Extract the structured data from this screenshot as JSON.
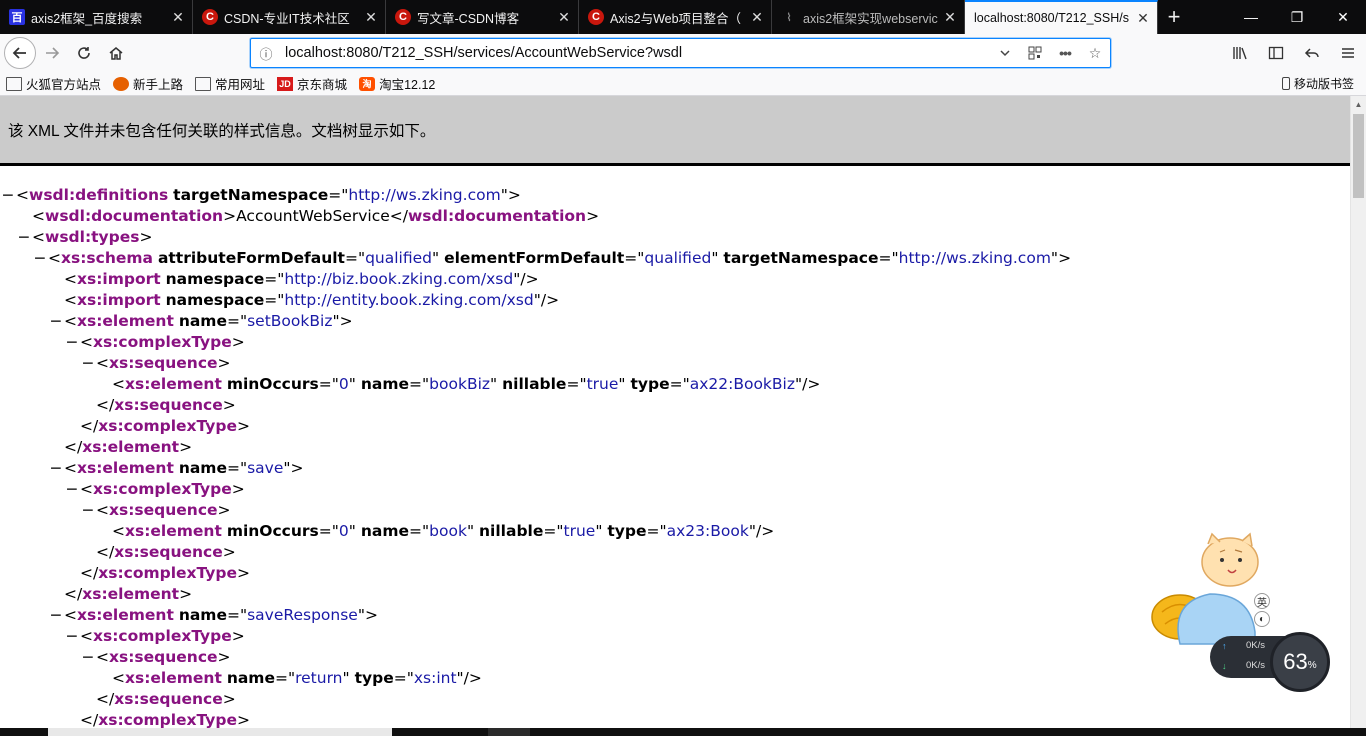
{
  "tabs": [
    {
      "title": "axis2框架_百度搜索",
      "favicon": "baidu-icon",
      "fav_text": "百"
    },
    {
      "title": "CSDN-专业IT技术社区",
      "favicon": "csdn-icon",
      "fav_text": "C"
    },
    {
      "title": "写文章-CSDN博客",
      "favicon": "csdn-icon",
      "fav_text": "C"
    },
    {
      "title": "Axis2与Web项目整合（",
      "favicon": "csdn-icon",
      "fav_text": "C"
    },
    {
      "title": "axis2框架实现webservic",
      "favicon": "gray-icon",
      "fav_text": "⌇"
    },
    {
      "title": "localhost:8080/T212_SSH/s",
      "favicon": "none",
      "fav_text": ""
    }
  ],
  "nav": {
    "url": "localhost:8080/T212_SSH/services/AccountWebService?wsdl",
    "page_actions_label": "•••"
  },
  "bookmarks": [
    {
      "label": "火狐官方站点",
      "icon": "folder-icon",
      "icon_text": ""
    },
    {
      "label": "新手上路",
      "icon": "firefox-icon",
      "icon_text": ""
    },
    {
      "label": "常用网址",
      "icon": "folder-icon",
      "icon_text": ""
    },
    {
      "label": "京东商城",
      "icon": "jd-icon",
      "icon_text": "JD"
    },
    {
      "label": "淘宝12.12",
      "icon": "taobao-icon",
      "icon_text": "淘"
    }
  ],
  "mobile_bookmarks": "移动版书签",
  "xml_notice": "该 XML 文件并未包含任何关联的样式信息。文档树显示如下。",
  "xml_lines": [
    {
      "indent": 0,
      "twisty": "−",
      "kind": "open",
      "tag": "wsdl:definitions",
      "attrs": [
        {
          "n": "targetNamespace",
          "v": "http://ws.zking.com"
        }
      ]
    },
    {
      "indent": 1,
      "twisty": "",
      "kind": "text",
      "tag": "wsdl:documentation",
      "text": "AccountWebService"
    },
    {
      "indent": 1,
      "twisty": "−",
      "kind": "open",
      "tag": "wsdl:types",
      "attrs": []
    },
    {
      "indent": 2,
      "twisty": "−",
      "kind": "open",
      "tag": "xs:schema",
      "attrs": [
        {
          "n": "attributeFormDefault",
          "v": "qualified"
        },
        {
          "n": "elementFormDefault",
          "v": "qualified"
        },
        {
          "n": "targetNamespace",
          "v": "http://ws.zking.com"
        }
      ]
    },
    {
      "indent": 3,
      "twisty": "",
      "kind": "empty",
      "tag": "xs:import",
      "attrs": [
        {
          "n": "namespace",
          "v": "http://biz.book.zking.com/xsd"
        }
      ]
    },
    {
      "indent": 3,
      "twisty": "",
      "kind": "empty",
      "tag": "xs:import",
      "attrs": [
        {
          "n": "namespace",
          "v": "http://entity.book.zking.com/xsd"
        }
      ]
    },
    {
      "indent": 3,
      "twisty": "−",
      "kind": "open",
      "tag": "xs:element",
      "attrs": [
        {
          "n": "name",
          "v": "setBookBiz"
        }
      ]
    },
    {
      "indent": 4,
      "twisty": "−",
      "kind": "open",
      "tag": "xs:complexType",
      "attrs": []
    },
    {
      "indent": 5,
      "twisty": "−",
      "kind": "open",
      "tag": "xs:sequence",
      "attrs": []
    },
    {
      "indent": 6,
      "twisty": "",
      "kind": "empty",
      "tag": "xs:element",
      "attrs": [
        {
          "n": "minOccurs",
          "v": "0"
        },
        {
          "n": "name",
          "v": "bookBiz"
        },
        {
          "n": "nillable",
          "v": "true"
        },
        {
          "n": "type",
          "v": "ax22:BookBiz"
        }
      ]
    },
    {
      "indent": 5,
      "twisty": "",
      "kind": "close",
      "tag": "xs:sequence"
    },
    {
      "indent": 4,
      "twisty": "",
      "kind": "close",
      "tag": "xs:complexType"
    },
    {
      "indent": 3,
      "twisty": "",
      "kind": "close",
      "tag": "xs:element"
    },
    {
      "indent": 3,
      "twisty": "−",
      "kind": "open",
      "tag": "xs:element",
      "attrs": [
        {
          "n": "name",
          "v": "save"
        }
      ]
    },
    {
      "indent": 4,
      "twisty": "−",
      "kind": "open",
      "tag": "xs:complexType",
      "attrs": []
    },
    {
      "indent": 5,
      "twisty": "−",
      "kind": "open",
      "tag": "xs:sequence",
      "attrs": []
    },
    {
      "indent": 6,
      "twisty": "",
      "kind": "empty",
      "tag": "xs:element",
      "attrs": [
        {
          "n": "minOccurs",
          "v": "0"
        },
        {
          "n": "name",
          "v": "book"
        },
        {
          "n": "nillable",
          "v": "true"
        },
        {
          "n": "type",
          "v": "ax23:Book"
        }
      ]
    },
    {
      "indent": 5,
      "twisty": "",
      "kind": "close",
      "tag": "xs:sequence"
    },
    {
      "indent": 4,
      "twisty": "",
      "kind": "close",
      "tag": "xs:complexType"
    },
    {
      "indent": 3,
      "twisty": "",
      "kind": "close",
      "tag": "xs:element"
    },
    {
      "indent": 3,
      "twisty": "−",
      "kind": "open",
      "tag": "xs:element",
      "attrs": [
        {
          "n": "name",
          "v": "saveResponse"
        }
      ]
    },
    {
      "indent": 4,
      "twisty": "−",
      "kind": "open",
      "tag": "xs:complexType",
      "attrs": []
    },
    {
      "indent": 5,
      "twisty": "−",
      "kind": "open",
      "tag": "xs:sequence",
      "attrs": []
    },
    {
      "indent": 6,
      "twisty": "",
      "kind": "empty",
      "tag": "xs:element",
      "attrs": [
        {
          "n": "name",
          "v": "return"
        },
        {
          "n": "type",
          "v": "xs:int"
        }
      ]
    },
    {
      "indent": 5,
      "twisty": "",
      "kind": "close",
      "tag": "xs:sequence"
    },
    {
      "indent": 4,
      "twisty": "",
      "kind": "close",
      "tag": "xs:complexType"
    }
  ],
  "widget": {
    "upload": "0K/s",
    "download": "0K/s",
    "percent": "63",
    "percent_unit": "%",
    "chip_label": "英"
  },
  "colors": {
    "tag": "#881280",
    "attr_value": "#1a1aa6",
    "accent": "#0a84ff"
  }
}
